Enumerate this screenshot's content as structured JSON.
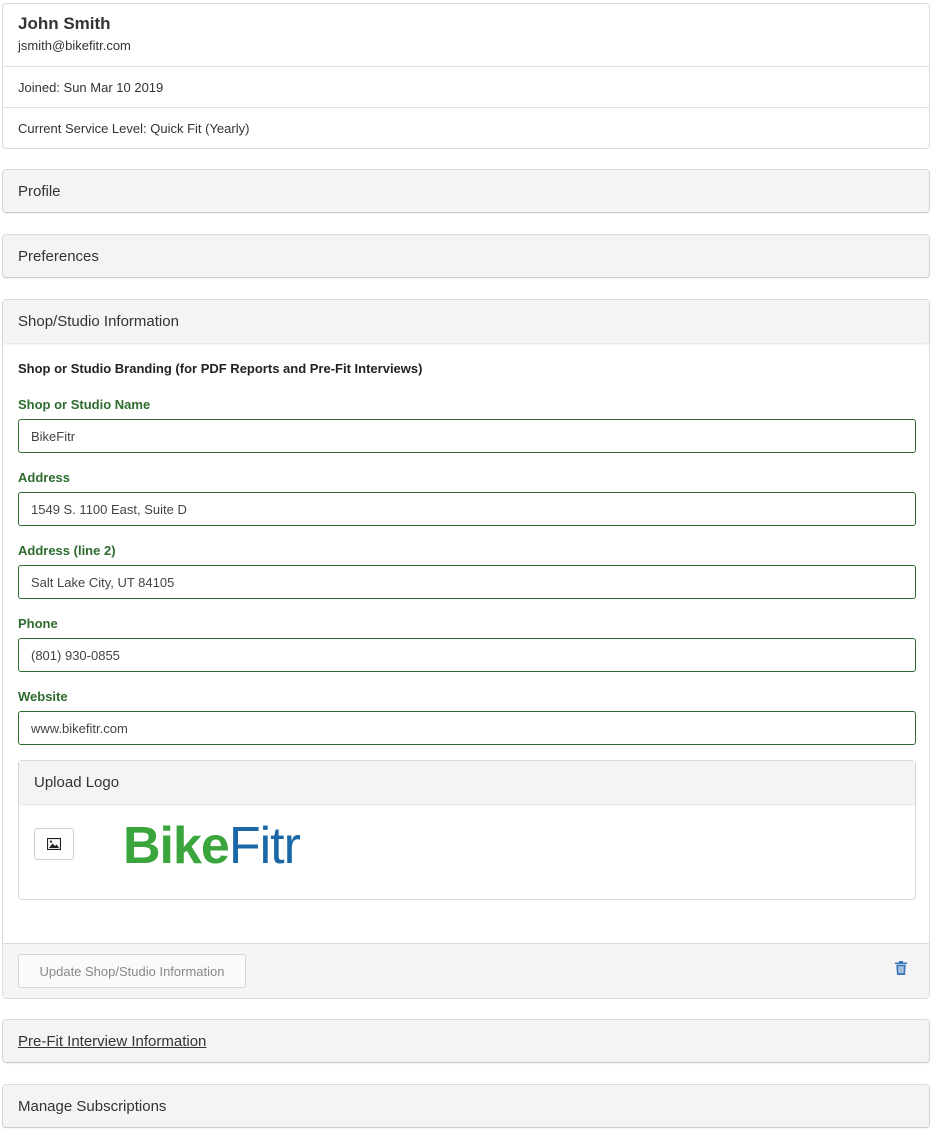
{
  "user": {
    "name": "John Smith",
    "email": "jsmith@bikefitr.com",
    "joined": "Joined: Sun Mar 10 2019",
    "service_level": "Current Service Level: Quick Fit (Yearly)"
  },
  "sections": {
    "profile": "Profile",
    "preferences": "Preferences",
    "shop": "Shop/Studio Information",
    "prefit": "Pre-Fit Interview Information",
    "subscriptions": "Manage Subscriptions"
  },
  "shop": {
    "branding_title": "Shop or Studio Branding (for PDF Reports and Pre-Fit Interviews)",
    "name_label": "Shop or Studio Name",
    "name_value": "BikeFitr",
    "address_label": "Address",
    "address_value": "1549 S. 1100 East, Suite D",
    "address2_label": "Address (line 2)",
    "address2_value": "Salt Lake City, UT 84105",
    "phone_label": "Phone",
    "phone_value": "(801) 930-0855",
    "website_label": "Website",
    "website_value": "www.bikefitr.com",
    "upload_logo": "Upload Logo",
    "logo_bike": "Bike",
    "logo_fitr": "Fitr",
    "update_button": "Update Shop/Studio Information"
  },
  "icons": {
    "image": "image-icon",
    "trash": "trash-icon"
  },
  "colors": {
    "label_green": "#2e6b2e",
    "logo_green": "#3aa53d",
    "logo_blue": "#1a67a8",
    "trash_blue": "#3b73b9"
  }
}
